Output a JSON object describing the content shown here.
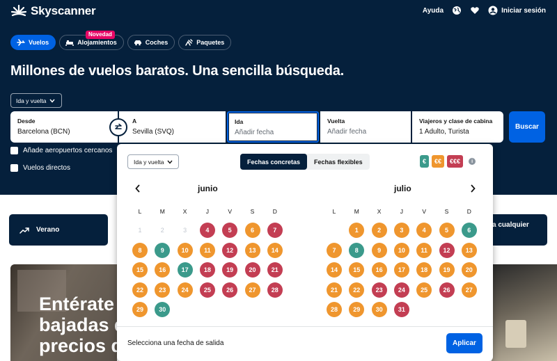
{
  "brand": {
    "name": "Skyscanner"
  },
  "topbar": {
    "help": "Ayuda",
    "login": "Iniciar sesión"
  },
  "tabs": [
    {
      "label": "Vuelos",
      "icon": "plane-icon",
      "active": true
    },
    {
      "label": "Alojamientos",
      "icon": "bed-icon",
      "active": false
    },
    {
      "label": "Coches",
      "icon": "car-icon",
      "active": false
    },
    {
      "label": "Paquetes",
      "icon": "package-icon",
      "active": false
    }
  ],
  "badge_new": "Novedad",
  "headline": "Millones de vuelos baratos. Una sencilla búsqueda.",
  "trip_type": "Ida y vuelta",
  "search": {
    "from_label": "Desde",
    "from_value": "Barcelona (BCN)",
    "to_label": "A",
    "to_value": "Sevilla (SVQ)",
    "depart_label": "Ida",
    "depart_placeholder": "Añadir fecha",
    "return_label": "Vuelta",
    "return_placeholder": "Añadir fecha",
    "pax_label": "Viajeros y clase de cabina",
    "pax_value": "1 Adulto, Turista",
    "button": "Buscar"
  },
  "checkboxes": {
    "nearby": "Añade aeropuertos cercanos",
    "direct": "Vuelos directos"
  },
  "cards": {
    "left": "Verano",
    "right": "a cualquier"
  },
  "promo": {
    "lines": [
      "Entérate",
      "bajadas d",
      "precios d"
    ]
  },
  "calendar": {
    "trip_type": "Ida y vuelta",
    "modes": [
      "Fechas concretas",
      "Fechas flexibles"
    ],
    "legend": [
      "€",
      "€€",
      "€€€"
    ],
    "weekdays": [
      "L",
      "M",
      "X",
      "J",
      "V",
      "S",
      "D"
    ],
    "footer_text": "Selecciona una fecha de salida",
    "apply": "Aplicar",
    "months": [
      {
        "name": "junio",
        "offset": 0,
        "days": 30,
        "colors": [
          "x",
          "x",
          "x",
          "r",
          "r",
          "o",
          "r",
          "o",
          "g",
          "o",
          "o",
          "r",
          "o",
          "o",
          "o",
          "o",
          "g",
          "r",
          "r",
          "r",
          "r",
          "o",
          "o",
          "o",
          "r",
          "r",
          "o",
          "r",
          "o",
          "g"
        ]
      },
      {
        "name": "julio",
        "offset": 1,
        "days": 31,
        "colors": [
          "o",
          "o",
          "o",
          "o",
          "o",
          "g",
          "o",
          "g",
          "o",
          "o",
          "o",
          "r",
          "o",
          "o",
          "o",
          "o",
          "o",
          "o",
          "o",
          "o",
          "o",
          "o",
          "r",
          "r",
          "o",
          "r",
          "o",
          "o",
          "o",
          "o",
          "r"
        ]
      }
    ]
  },
  "colors": {
    "green": "#3b9a8b",
    "orange": "#ef962e",
    "red": "#c33e53",
    "navy": "#05203c",
    "blue": "#0062e3"
  }
}
